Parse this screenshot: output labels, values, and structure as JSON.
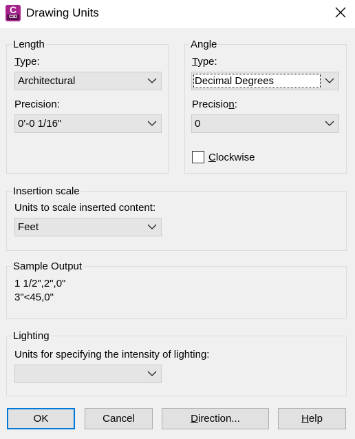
{
  "window": {
    "title": "Drawing Units",
    "app_icon": {
      "letter": "C",
      "badge": "C3D",
      "color": "#a4228a"
    }
  },
  "length": {
    "legend": "Length",
    "type_label_prefix": "",
    "type_label_hotkey": "T",
    "type_label_rest": "ype:",
    "type_value": "Architectural",
    "precision_label": "Precision:",
    "precision_value": "0'-0 1/16\""
  },
  "angle": {
    "legend": "Angle",
    "type_label_hotkey": "T",
    "type_label_rest": "ype:",
    "type_value": "Decimal Degrees",
    "precision_label_prefix": "Precisio",
    "precision_label_hotkey": "n",
    "precision_label_rest": ":",
    "precision_value": "0",
    "clockwise_hotkey": "C",
    "clockwise_rest": "lockwise",
    "clockwise_checked": false
  },
  "insertion": {
    "legend": "Insertion scale",
    "label": "Units to scale inserted content:",
    "value": "Feet"
  },
  "sample": {
    "legend": "Sample Output",
    "line1": "1 1/2\",2\",0\"",
    "line2": "3\"<45,0\""
  },
  "lighting": {
    "legend": "Lighting",
    "label": "Units for specifying the intensity of lighting:",
    "value": ""
  },
  "buttons": {
    "ok": "OK",
    "cancel": "Cancel",
    "direction_hotkey": "D",
    "direction_rest": "irection...",
    "help_hotkey": "H",
    "help_rest": "elp"
  },
  "colors": {
    "accent": "#0078d7",
    "background": "#f0f0f0"
  }
}
